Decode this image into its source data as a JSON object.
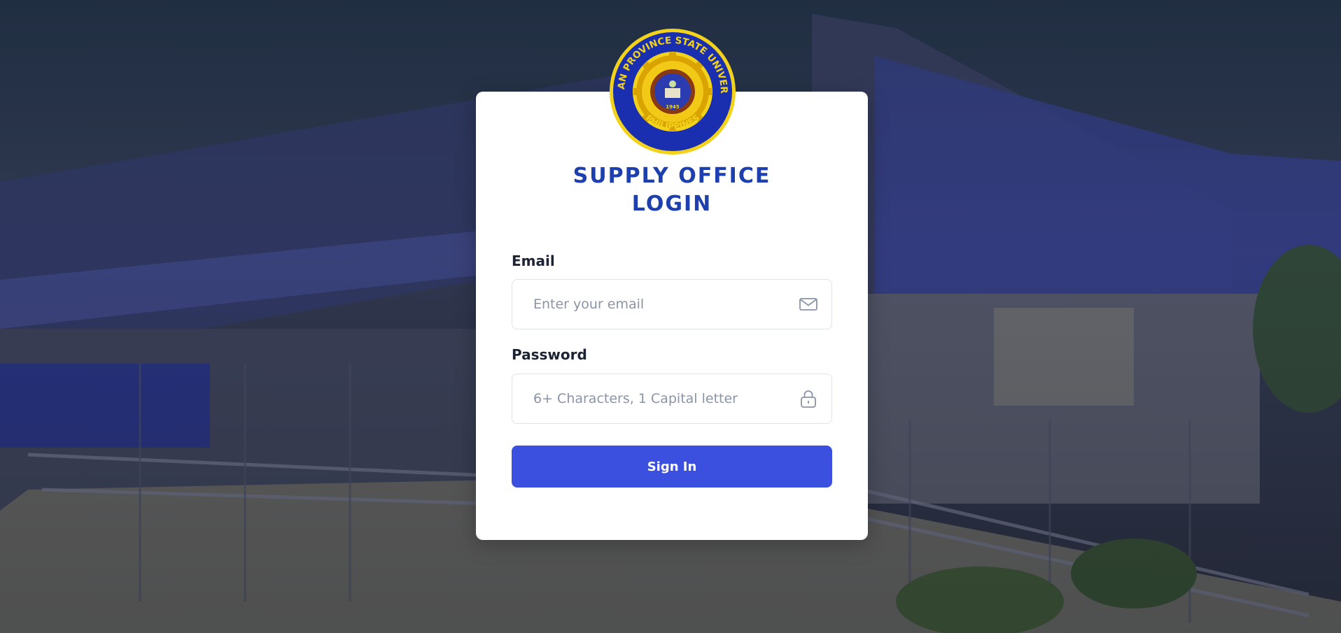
{
  "logo": {
    "top_text": "BILIRAN PROVINCE STATE UNIVERSITY",
    "bottom_text": "PHILIPPINES",
    "year": "1945"
  },
  "login": {
    "title_line1": "SUPPLY OFFICE",
    "title_line2": "LOGIN",
    "email_label": "Email",
    "email_placeholder": "Enter your email",
    "email_value": "",
    "password_label": "Password",
    "password_placeholder": "6+ Characters, 1 Capital letter",
    "password_value": "",
    "signin_label": "Sign In"
  },
  "icons": {
    "email": "mail-icon",
    "password": "lock-icon"
  },
  "colors": {
    "title": "#1e40af",
    "button": "#3c50e0",
    "logo_ring": "#1a2fb0",
    "logo_gold": "#f2d21a"
  }
}
